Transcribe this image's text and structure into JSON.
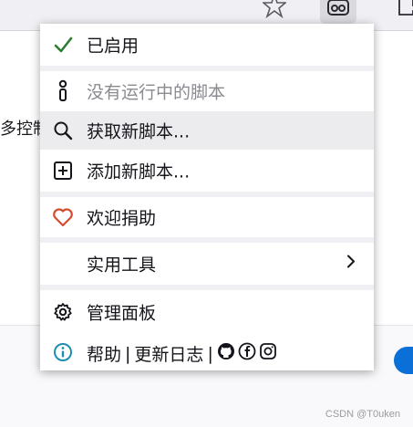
{
  "menu": {
    "enabled_label": "已启用",
    "no_scripts_label": "没有运行中的脚本",
    "get_scripts_label": "获取新脚本...",
    "add_script_label": "添加新脚本...",
    "donate_label": "欢迎捐助",
    "utilities_label": "实用工具",
    "dashboard_label": "管理面板",
    "help_label": "帮助",
    "separator": "|",
    "changelog_label": "更新日志"
  },
  "background": {
    "partial_text": "多控制"
  },
  "watermark": "CSDN @T0uken",
  "colors": {
    "check": "#2e7d32",
    "heart": "#d84a2e",
    "info": "#1e8db3",
    "accent_blue": "#0b6fd8"
  }
}
